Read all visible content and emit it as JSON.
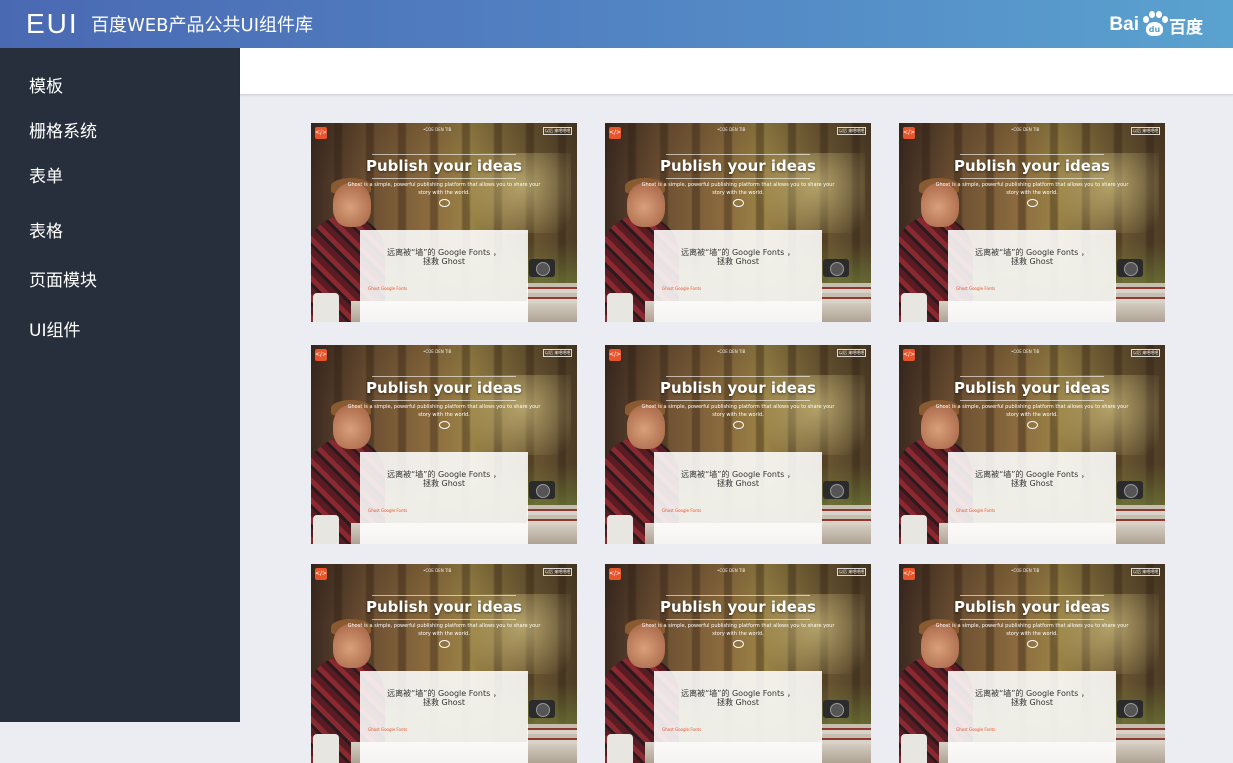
{
  "header": {
    "logo": "EUI",
    "subtitle": "百度WEB产品公共UI组件库",
    "baidu_logo": {
      "bai": "Bai",
      "du": "du",
      "zh": "百度"
    }
  },
  "sidebar": {
    "items": [
      {
        "label": "模板"
      },
      {
        "label": "栅格系统"
      },
      {
        "label": "表单"
      },
      {
        "label": "表格"
      },
      {
        "label": "页面模块"
      },
      {
        "label": "UI组件"
      }
    ]
  },
  "card_template": {
    "logo_glyph": "</>",
    "topnav": "•COE DEN   TIB",
    "topnav_right": "以后 来吧吧吧",
    "headline": "Publish your ideas",
    "description": "Ghost is a simple, powerful publishing platform that allows you to share your story with the world.",
    "panel_title_line1": "远离被“墙”的 Google Fonts ，",
    "panel_title_line2": "拯救 Ghost",
    "panel_links": "Ghost   Google Fonts"
  },
  "cards": [
    {
      "id": 1
    },
    {
      "id": 2
    },
    {
      "id": 3
    },
    {
      "id": 4
    },
    {
      "id": 5
    },
    {
      "id": 6
    },
    {
      "id": 7
    },
    {
      "id": 8
    },
    {
      "id": 9
    }
  ],
  "colors": {
    "header_gradient_start": "#4a69b3",
    "header_gradient_end": "#5aa2cf",
    "sidebar_bg": "#272f3c",
    "content_bg": "#ecedf2",
    "accent_orange": "#e8552a"
  }
}
